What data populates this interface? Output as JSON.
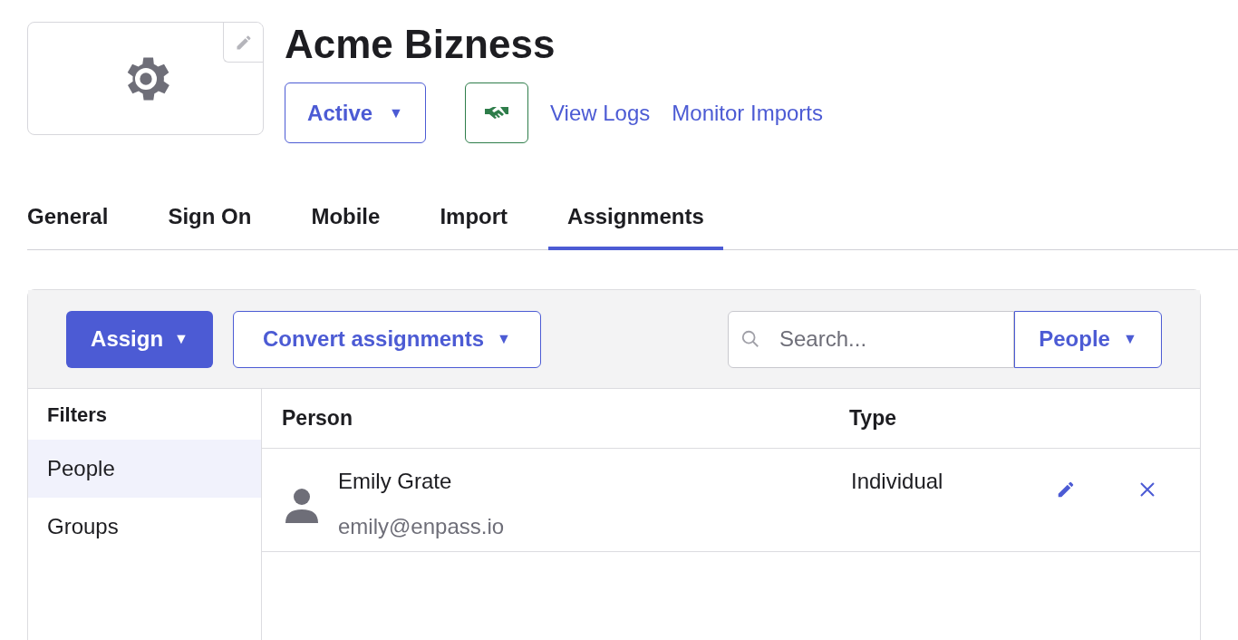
{
  "app": {
    "name": "Acme Bizness",
    "status": {
      "label": "Active",
      "caret": "▼"
    },
    "links": [
      "View Logs",
      "Monitor Imports"
    ]
  },
  "tabs": [
    {
      "label": "General",
      "selected": false
    },
    {
      "label": "Sign On",
      "selected": false
    },
    {
      "label": "Mobile",
      "selected": false
    },
    {
      "label": "Import",
      "selected": false
    },
    {
      "label": "Assignments",
      "selected": true
    }
  ],
  "toolbar": {
    "assign": {
      "label": "Assign",
      "caret": "▼"
    },
    "convert": {
      "label": "Convert assignments",
      "caret": "▼"
    },
    "search": {
      "placeholder": "Search..."
    },
    "scope": {
      "label": "People",
      "caret": "▼"
    }
  },
  "filters": {
    "title": "Filters",
    "items": [
      {
        "label": "People",
        "selected": true
      },
      {
        "label": "Groups",
        "selected": false
      }
    ]
  },
  "table": {
    "columns": [
      "Person",
      "Type"
    ],
    "rows": [
      {
        "name": "Emily Grate",
        "email": "emily@enpass.io",
        "type": "Individual"
      }
    ]
  }
}
